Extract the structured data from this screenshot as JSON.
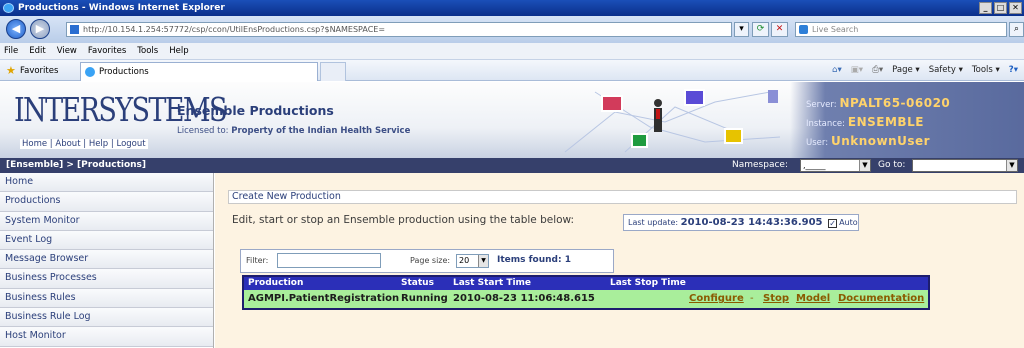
{
  "browser": {
    "title": "Productions - Windows Internet Explorer",
    "address": "http://10.154.1.254:57772/csp/ccon/UtilEnsProductions.csp?$NAMESPACE=",
    "address_host": "10.154.1.254",
    "search_placeholder": "Live Search",
    "menu": [
      "File",
      "Edit",
      "View",
      "Favorites",
      "Tools",
      "Help"
    ],
    "favorites_label": "Favorites",
    "tab_label": "Productions",
    "commands": [
      "Page ▾",
      "Safety ▾",
      "Tools ▾"
    ]
  },
  "header": {
    "logo_text": "INTERSYSTEMS",
    "logo_links": [
      "Home",
      "About",
      "Help",
      "Logout"
    ],
    "title": "Ensemble Productions",
    "licensed_label": "Licensed to:",
    "licensed_value": "Property of the Indian Health Service",
    "server_label": "Server:",
    "server_value": "NPALT65-06020",
    "instance_label": "Instance:",
    "instance_value": "ENSEMBLE",
    "user_label": "User:",
    "user_value": "UnknownUser"
  },
  "crumb": {
    "text": "[Ensemble] > [Productions]",
    "namespace_label": "Namespace:",
    "namespace_value": ",_____",
    "goto_label": "Go to:",
    "goto_value": ""
  },
  "left_menu": [
    "Home",
    "Productions",
    "System Monitor",
    "Event Log",
    "Message Browser",
    "Business Processes",
    "Business Rules",
    "Business Rule Log",
    "Host Monitor"
  ],
  "main": {
    "create_new": "Create New Production",
    "edit_line": "Edit, start or stop an Ensemble production using the table below:",
    "last_update_label": "Last update:",
    "last_update_value": "2010-08-23 14:43:36.905",
    "auto_label": "Auto",
    "auto_checked": true,
    "filter_label": "Filter:",
    "filter_value": "",
    "page_size_label": "Page size:",
    "page_size_value": "20",
    "items_found": "Items found: 1",
    "table": {
      "headers": [
        "Production",
        "Status",
        "Last Start Time",
        "Last Stop Time"
      ],
      "rows": [
        {
          "production": "AGMPI.PatientRegistration",
          "status": "Running",
          "last_start": "2010-08-23 11:06:48.615",
          "last_stop": "",
          "actions": [
            "Configure",
            "Stop",
            "Model",
            "Documentation"
          ],
          "separator": "-"
        }
      ]
    }
  }
}
